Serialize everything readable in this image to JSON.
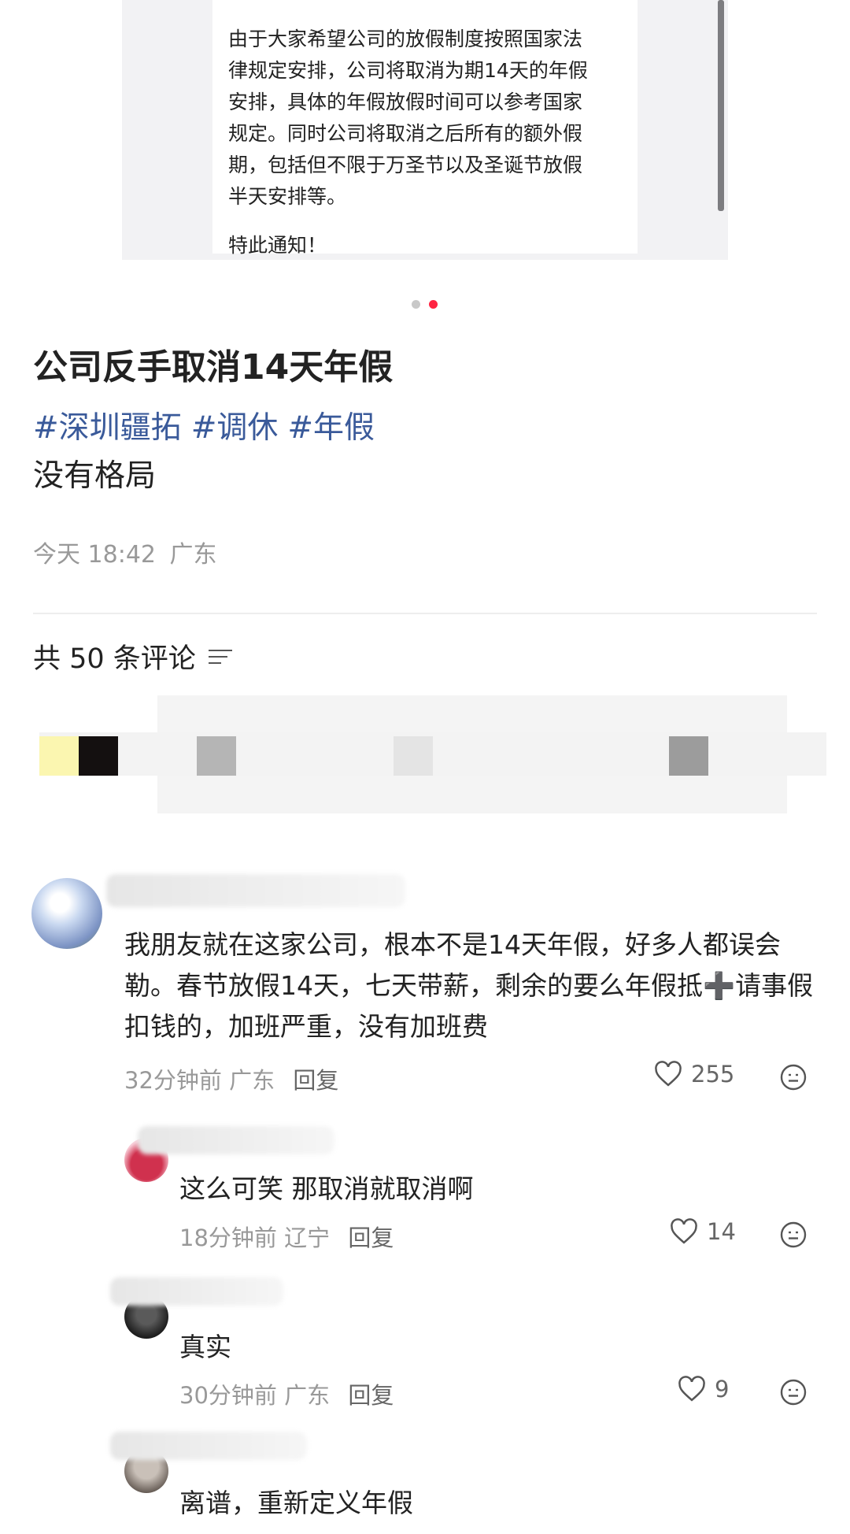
{
  "notice": {
    "body": "由于大家希望公司的放假制度按照国家法\n律规定安排，公司将取消为期14天的年假\n安排，具体的年假放假时间可以参考国家\n规定。同时公司将取消之后所有的额外假\n期，包括但不限于万圣节以及圣诞节放假\n半天安排等。",
    "sign": "特此通知！"
  },
  "carousel": {
    "total": 2,
    "active": 2
  },
  "post": {
    "title": "公司反手取消14天年假",
    "tags": [
      "#深圳疆拓",
      "#调休",
      "#年假"
    ],
    "body": "没有格局",
    "time": "今天 18:42",
    "location": "广东"
  },
  "comments_header": {
    "label": "共 50 条评论"
  },
  "comments": [
    {
      "text": "我朋友就在这家公司，根本不是14天年假，好多人都误会勒。春节放假14天，七天带薪，剩余的要么年假抵➕请事假扣钱的，加班严重，没有加班费",
      "time": "32分钟前",
      "location": "广东",
      "reply": "回复",
      "likes": "255"
    },
    {
      "text": "这么可笑 那取消就取消啊",
      "time": "18分钟前",
      "location": "辽宁",
      "reply": "回复",
      "likes": "14"
    },
    {
      "text": "真实",
      "time": "30分钟前",
      "location": "广东",
      "reply": "回复",
      "likes": "9"
    },
    {
      "text": "离谱，重新定义年假"
    }
  ],
  "colors": {
    "accent_red": "#ff2442",
    "tag_blue": "#3a5a9a",
    "meta_gray": "#999999"
  },
  "icons": {
    "like": "heart-outline-icon",
    "emoji": "emoji-face-icon",
    "sort": "sort-lines-icon"
  }
}
